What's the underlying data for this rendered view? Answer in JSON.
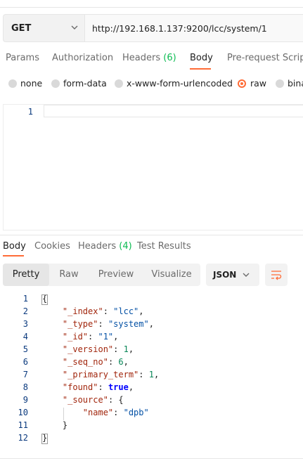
{
  "request": {
    "method": "GET",
    "url": "http://192.168.1.137:9200/lcc/system/1"
  },
  "request_tabs": [
    {
      "label": "Params",
      "count": ""
    },
    {
      "label": "Authorization",
      "count": ""
    },
    {
      "label": "Headers",
      "count": "(6)"
    },
    {
      "label": "Body",
      "count": "",
      "active": true
    },
    {
      "label": "Pre-request Script",
      "count": ""
    }
  ],
  "body_types": [
    {
      "label": "none",
      "selected": false
    },
    {
      "label": "form-data",
      "selected": false
    },
    {
      "label": "x-www-form-urlencoded",
      "selected": false
    },
    {
      "label": "raw",
      "selected": true
    },
    {
      "label": "bina",
      "selected": false
    }
  ],
  "editor": {
    "line_numbers": [
      "1"
    ]
  },
  "response_tabs": [
    {
      "label": "Body",
      "count": "",
      "active": true
    },
    {
      "label": "Cookies",
      "count": ""
    },
    {
      "label": "Headers",
      "count": "(4)"
    },
    {
      "label": "Test Results",
      "count": ""
    }
  ],
  "view_modes": [
    {
      "label": "Pretty",
      "active": true
    },
    {
      "label": "Raw",
      "active": false
    },
    {
      "label": "Preview",
      "active": false
    },
    {
      "label": "Visualize",
      "active": false
    }
  ],
  "format": {
    "label": "JSON"
  },
  "icons": {
    "method_chevron": "chevron-down-icon",
    "format_chevron": "chevron-down-icon",
    "wrap": "wrap-lines-icon"
  },
  "colors": {
    "accent": "#ff6c37",
    "count": "#0cbb52",
    "json_key": "#a1260d",
    "json_string": "#0451a5",
    "json_number": "#098658",
    "json_bool": "#0000ff",
    "line_number": "#0b3a7e"
  },
  "response_code": [
    {
      "n": "1",
      "parts": [
        [
          "p",
          "{"
        ]
      ]
    },
    {
      "n": "2",
      "parts": [
        [
          "p",
          "    "
        ],
        [
          "k",
          "\"_index\""
        ],
        [
          "p",
          ": "
        ],
        [
          "s",
          "\"lcc\""
        ],
        [
          "p",
          ","
        ]
      ]
    },
    {
      "n": "3",
      "parts": [
        [
          "p",
          "    "
        ],
        [
          "k",
          "\"_type\""
        ],
        [
          "p",
          ": "
        ],
        [
          "s",
          "\"system\""
        ],
        [
          "p",
          ","
        ]
      ]
    },
    {
      "n": "4",
      "parts": [
        [
          "p",
          "    "
        ],
        [
          "k",
          "\"_id\""
        ],
        [
          "p",
          ": "
        ],
        [
          "s",
          "\"1\""
        ],
        [
          "p",
          ","
        ]
      ]
    },
    {
      "n": "5",
      "parts": [
        [
          "p",
          "    "
        ],
        [
          "k",
          "\"_version\""
        ],
        [
          "p",
          ": "
        ],
        [
          "n",
          "1"
        ],
        [
          "p",
          ","
        ]
      ]
    },
    {
      "n": "6",
      "parts": [
        [
          "p",
          "    "
        ],
        [
          "k",
          "\"_seq_no\""
        ],
        [
          "p",
          ": "
        ],
        [
          "n",
          "6"
        ],
        [
          "p",
          ","
        ]
      ]
    },
    {
      "n": "7",
      "parts": [
        [
          "p",
          "    "
        ],
        [
          "k",
          "\"_primary_term\""
        ],
        [
          "p",
          ": "
        ],
        [
          "n",
          "1"
        ],
        [
          "p",
          ","
        ]
      ]
    },
    {
      "n": "8",
      "parts": [
        [
          "p",
          "    "
        ],
        [
          "k",
          "\"found\""
        ],
        [
          "p",
          ": "
        ],
        [
          "b",
          "true"
        ],
        [
          "p",
          ","
        ]
      ]
    },
    {
      "n": "9",
      "parts": [
        [
          "p",
          "    "
        ],
        [
          "k",
          "\"_source\""
        ],
        [
          "p",
          ": {"
        ]
      ]
    },
    {
      "n": "10",
      "parts": [
        [
          "p",
          "        "
        ],
        [
          "k",
          "\"name\""
        ],
        [
          "p",
          ": "
        ],
        [
          "s",
          "\"dpb\""
        ]
      ]
    },
    {
      "n": "11",
      "parts": [
        [
          "p",
          "    }"
        ]
      ]
    },
    {
      "n": "12",
      "parts": [
        [
          "p",
          "}"
        ]
      ]
    }
  ]
}
